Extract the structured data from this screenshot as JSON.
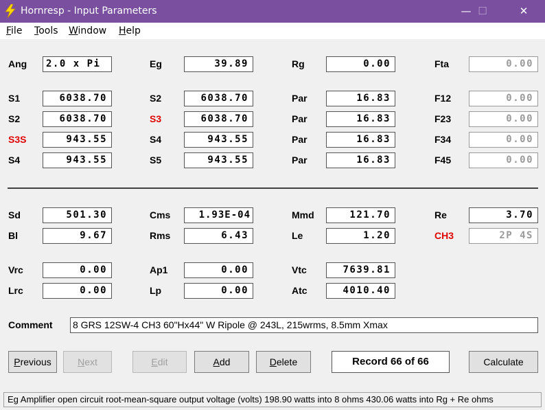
{
  "window": {
    "title": "Hornresp - Input Parameters",
    "minimize": "—",
    "maximize": "☐",
    "close": "✕",
    "colors": {
      "titlebar": "#7a4fa0",
      "red_label": "#e00000"
    }
  },
  "menu": {
    "file": "File",
    "tools": "Tools",
    "window": "Window",
    "help": "Help"
  },
  "horn": {
    "ang": {
      "label": "Ang",
      "value": "2.0 x Pi"
    },
    "eg": {
      "label": "Eg",
      "value": "39.89"
    },
    "rg": {
      "label": "Rg",
      "value": "0.00"
    },
    "fta": {
      "label": "Fta",
      "value": "0.00"
    },
    "rows": [
      {
        "a_label": "S1",
        "a_value": "6038.70",
        "b_label": "S2",
        "b_value": "6038.70",
        "c_label": "Par",
        "c_value": "16.83",
        "d_label": "F12",
        "d_value": "0.00"
      },
      {
        "a_label": "S2",
        "a_value": "6038.70",
        "b_label": "S3",
        "b_value": "6038.70",
        "c_label": "Par",
        "c_value": "16.83",
        "d_label": "F23",
        "d_value": "0.00"
      },
      {
        "a_label": "S3S",
        "a_value": "943.55",
        "b_label": "S4",
        "b_value": "943.55",
        "c_label": "Par",
        "c_value": "16.83",
        "d_label": "F34",
        "d_value": "0.00"
      },
      {
        "a_label": "S4",
        "a_value": "943.55",
        "b_label": "S5",
        "b_value": "943.55",
        "c_label": "Par",
        "c_value": "16.83",
        "d_label": "F45",
        "d_value": "0.00"
      }
    ]
  },
  "driver": {
    "sd": {
      "label": "Sd",
      "value": "501.30"
    },
    "cms": {
      "label": "Cms",
      "value": "1.93E-04"
    },
    "mmd": {
      "label": "Mmd",
      "value": "121.70"
    },
    "re": {
      "label": "Re",
      "value": "3.70"
    },
    "bl": {
      "label": "Bl",
      "value": "9.67"
    },
    "rms": {
      "label": "Rms",
      "value": "6.43"
    },
    "le": {
      "label": "Le",
      "value": "1.20"
    },
    "ch3": {
      "label": "CH3",
      "value": "2P 4S"
    },
    "vrc": {
      "label": "Vrc",
      "value": "0.00"
    },
    "ap1": {
      "label": "Ap1",
      "value": "0.00"
    },
    "vtc": {
      "label": "Vtc",
      "value": "7639.81"
    },
    "lrc": {
      "label": "Lrc",
      "value": "0.00"
    },
    "lp": {
      "label": "Lp",
      "value": "0.00"
    },
    "atc": {
      "label": "Atc",
      "value": "4010.40"
    }
  },
  "comment": {
    "label": "Comment",
    "value": "8 GRS 12SW-4 CH3 60\"Hx44\" W Ripole @ 243L, 215wrms, 8.5mm Xmax"
  },
  "buttons": {
    "previous": "Previous",
    "next": "Next",
    "edit": "Edit",
    "add": "Add",
    "delete": "Delete",
    "record": "Record 66 of 66",
    "calculate": "Calculate"
  },
  "status": "Eg   Amplifier open circuit root-mean-square output voltage  (volts)   198.90 watts into 8 ohms    430.06 watts into Rg + Re ohms"
}
